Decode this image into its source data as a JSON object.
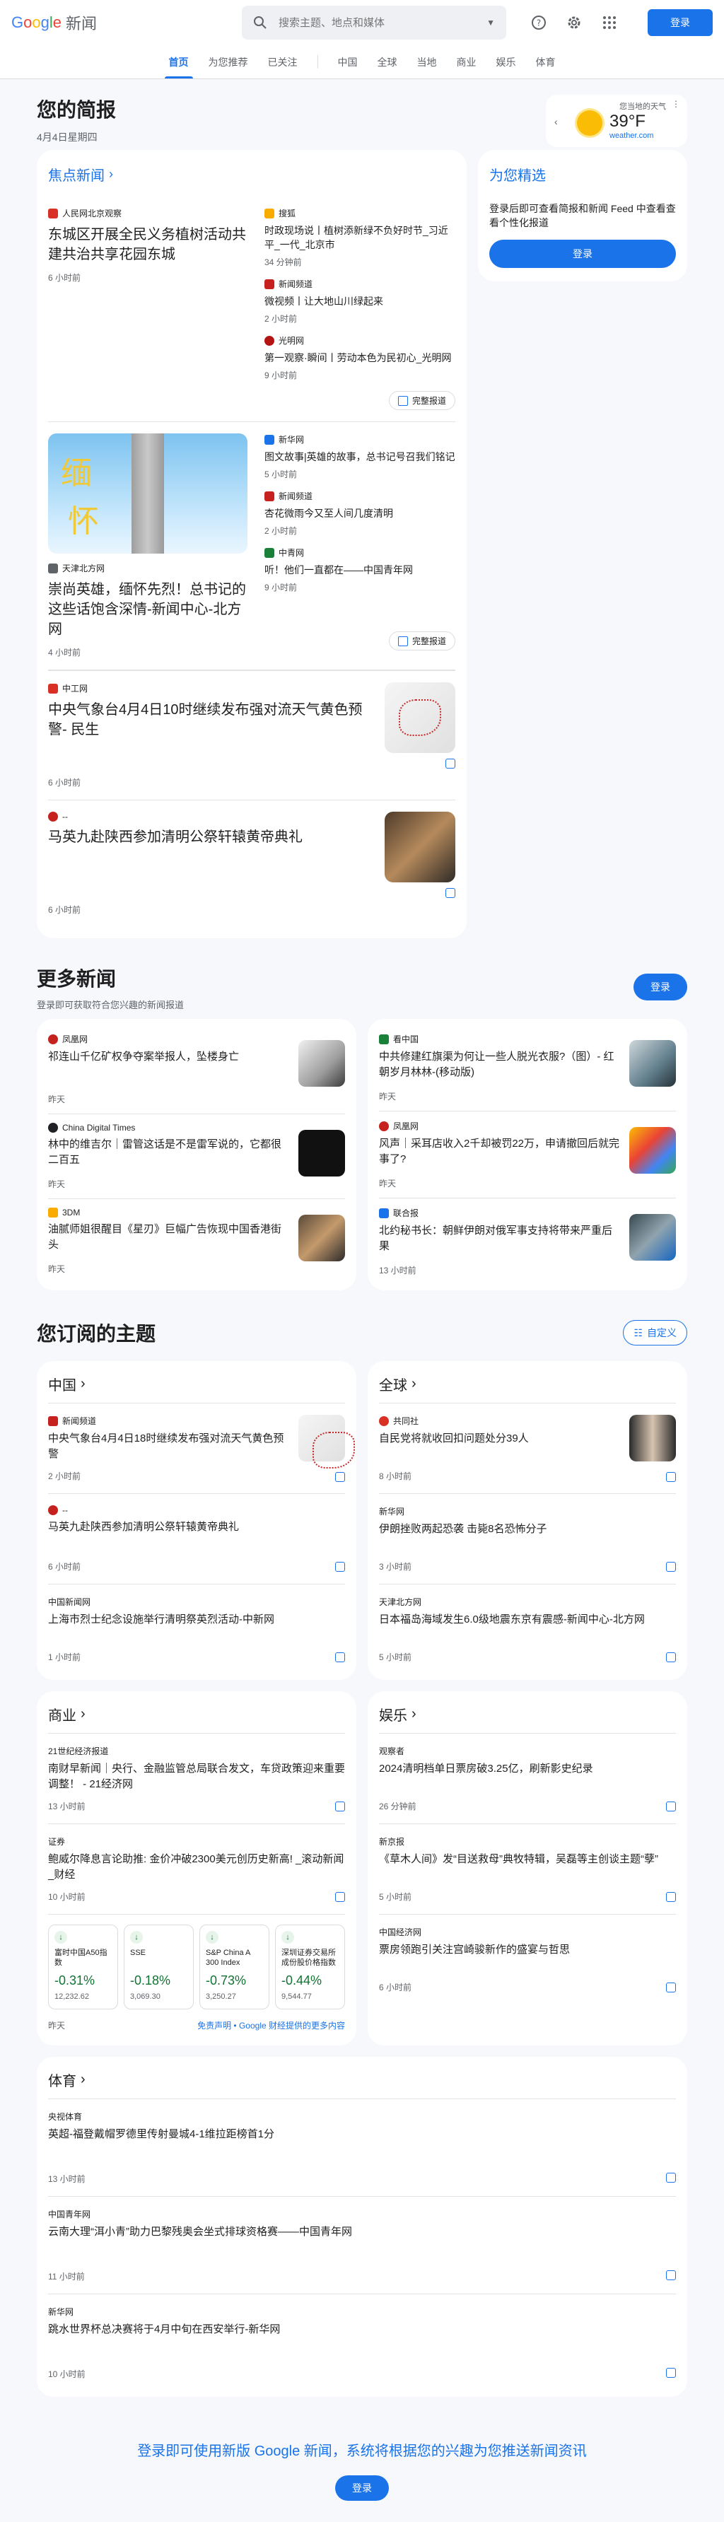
{
  "header": {
    "logo_g": "G",
    "logo_o1": "o",
    "logo_o2": "o",
    "logo_g2": "g",
    "logo_l": "l",
    "logo_e": "e",
    "logo_news": "新闻",
    "search_placeholder": "搜索主题、地点和媒体",
    "signin": "登录"
  },
  "nav": {
    "tabs": [
      "首页",
      "为您推荐",
      "已关注"
    ],
    "topics": [
      "中国",
      "全球",
      "当地",
      "商业",
      "娱乐",
      "体育"
    ]
  },
  "briefing": {
    "title": "您的简报",
    "date": "4月4日星期四",
    "weather": {
      "location": "您当地的天气",
      "temp": "39°F",
      "source": "weather.com"
    }
  },
  "top_stories": {
    "title": "焦点新闻",
    "full_coverage": "完整报道",
    "clusters": [
      {
        "main": {
          "source": "人民网北京观察",
          "headline": "东城区开展全民义务植树活动共建共治共享花园东城",
          "time": "6 小时前"
        },
        "side": [
          {
            "source": "搜狐",
            "headline": "时政现场说丨植树添新绿不负好时节_习近平_一代_北京市",
            "time": "34 分钟前"
          },
          {
            "source": "新闻频道",
            "headline": "微视频丨让大地山川绿起来",
            "time": "2 小时前"
          },
          {
            "source": "光明网",
            "headline": "第一观察·瞬间丨劳动本色为民初心_光明网",
            "time": "9 小时前"
          }
        ]
      },
      {
        "main": {
          "source": "天津北方网",
          "headline": "崇尚英雄，缅怀先烈！总书记的这些话饱含深情-新闻中心-北方网",
          "time": "4 小时前"
        },
        "side": [
          {
            "source": "新华网",
            "headline": "图文故事|英雄的故事，总书记号召我们铭记",
            "time": "5 小时前"
          },
          {
            "source": "新闻频道",
            "headline": "杏花微雨今又至人间几度清明",
            "time": "2 小时前"
          },
          {
            "source": "中青网",
            "headline": "听！他们一直都在——中国青年网",
            "time": "9 小时前"
          }
        ]
      }
    ],
    "rows": [
      {
        "source": "中工网",
        "headline": "中央气象台4月4日10时继续发布强对流天气黄色预警- 民生",
        "time": "6 小时前"
      },
      {
        "source": "--",
        "headline": "马英九赴陕西参加清明公祭轩辕黄帝典礼",
        "time": "6 小时前"
      }
    ]
  },
  "picks": {
    "title": "为您精选",
    "desc": "登录后即可查看简报和新闻 Feed 中查看查看个性化报道",
    "button": "登录"
  },
  "more": {
    "title": "更多新闻",
    "subtitle": "登录即可获取符合您兴趣的新闻报道",
    "button": "登录",
    "left": [
      {
        "source": "凤凰网",
        "headline": "祁连山千亿矿权争夺案举报人，坠楼身亡",
        "time": "昨天"
      },
      {
        "source": "China Digital Times",
        "headline": "林中的维吉尔｜雷管这话是不是雷军说的，它都很二百五",
        "time": "昨天"
      },
      {
        "source": "3DM",
        "headline": "油腻师姐很醒目《星刃》巨幅广告恢现中国香港街头",
        "time": "昨天"
      }
    ],
    "right": [
      {
        "source": "看中国",
        "headline": "中共修建红旗渠为何让一些人脱光衣服?（图）- 红朝岁月林林-(移动版)",
        "time": "昨天"
      },
      {
        "source": "凤凰网",
        "headline": "风声｜采耳店收入2千却被罚22万，申请撤回后就完事了?",
        "time": "昨天"
      },
      {
        "source": "联合报",
        "headline": "北约秘书长：朝鲜伊朗对俄军事支持将带来严重后果",
        "time": "13 小时前"
      }
    ]
  },
  "topics": {
    "title": "您订阅的主题",
    "customize": "自定义",
    "china": {
      "title": "中国",
      "items": [
        {
          "source": "新闻频道",
          "headline": "中央气象台4月4日18时继续发布强对流天气黄色预警",
          "time": "2 小时前"
        },
        {
          "source": "--",
          "headline": "马英九赴陕西参加清明公祭轩辕黄帝典礼",
          "time": "6 小时前"
        },
        {
          "source": "中国新闻网",
          "headline": "上海市烈士纪念设施举行清明祭英烈活动-中新网",
          "time": "1 小时前"
        }
      ]
    },
    "world": {
      "title": "全球",
      "items": [
        {
          "source": "共同社",
          "headline": "自民党将就收回扣问题处分39人",
          "time": "8 小时前"
        },
        {
          "source": "新华网",
          "headline": "伊朗挫败两起恐袭 击毙8名恐怖分子",
          "time": "3 小时前"
        },
        {
          "source": "天津北方网",
          "headline": "日本福岛海域发生6.0级地震东京有震感-新闻中心-北方网",
          "time": "5 小时前"
        }
      ]
    },
    "business": {
      "title": "商业",
      "items": [
        {
          "source": "21世纪经济报道",
          "headline": "南财早新闻｜央行、金融监管总局联合发文，车贷政策迎来重要调整！ - 21经济网",
          "time": "13 小时前"
        },
        {
          "source": "证券",
          "headline": "鲍威尔降息言论助推: 金价冲破2300美元创历史新高! _滚动新闻_财经",
          "time": "10 小时前"
        }
      ],
      "stocks": [
        {
          "name": "富时中国A50指数",
          "change": "-0.31%",
          "value": "12,232.62"
        },
        {
          "name": "SSE",
          "change": "-0.18%",
          "value": "3,069.30"
        },
        {
          "name": "S&P China A 300 Index (CNY)",
          "change": "-0.73%",
          "value": "3,250.27"
        },
        {
          "name": "深圳证券交易所成份股价格指数",
          "change": "-0.44%",
          "value": "9,544.77"
        }
      ],
      "stocks_time": "昨天",
      "disclaimer": "免责声明 • Google 财经提供的更多内容"
    },
    "entertainment": {
      "title": "娱乐",
      "items": [
        {
          "source": "观察者",
          "headline": "2024清明档单日票房破3.25亿，刷新影史纪录",
          "time": "26 分钟前"
        },
        {
          "source": "新京报",
          "headline": "《草木人间》发“目送救母”典牧特辑，吴磊等主创谈主题“孽”",
          "time": "5 小时前"
        },
        {
          "source": "中国经济网",
          "headline": "票房领跑引关注宫崎骏新作的盛宴与哲思",
          "time": "6 小时前"
        }
      ]
    },
    "sports": {
      "title": "体育",
      "items": [
        {
          "source": "央视体育",
          "headline": "英超-福登戴帽罗德里传射曼城4-1维拉距榜首1分",
          "time": "13 小时前"
        },
        {
          "source": "中国青年网",
          "headline": "云南大理“洱小青”助力巴黎残奥会坐式排球资格赛——中国青年网",
          "time": "11 小时前"
        },
        {
          "source": "新华网",
          "headline": "跳水世界杯总决赛将于4月中旬在西安举行-新华网",
          "time": "10 小时前"
        }
      ]
    }
  },
  "footer": {
    "text": "登录即可使用新版 Google 新闻，系统将根据您的兴趣为您推送新闻资讯",
    "button": "登录"
  },
  "colors": {
    "accent": "#1a73e8",
    "positive_change": "#137333",
    "background": "#f6f8fc"
  }
}
